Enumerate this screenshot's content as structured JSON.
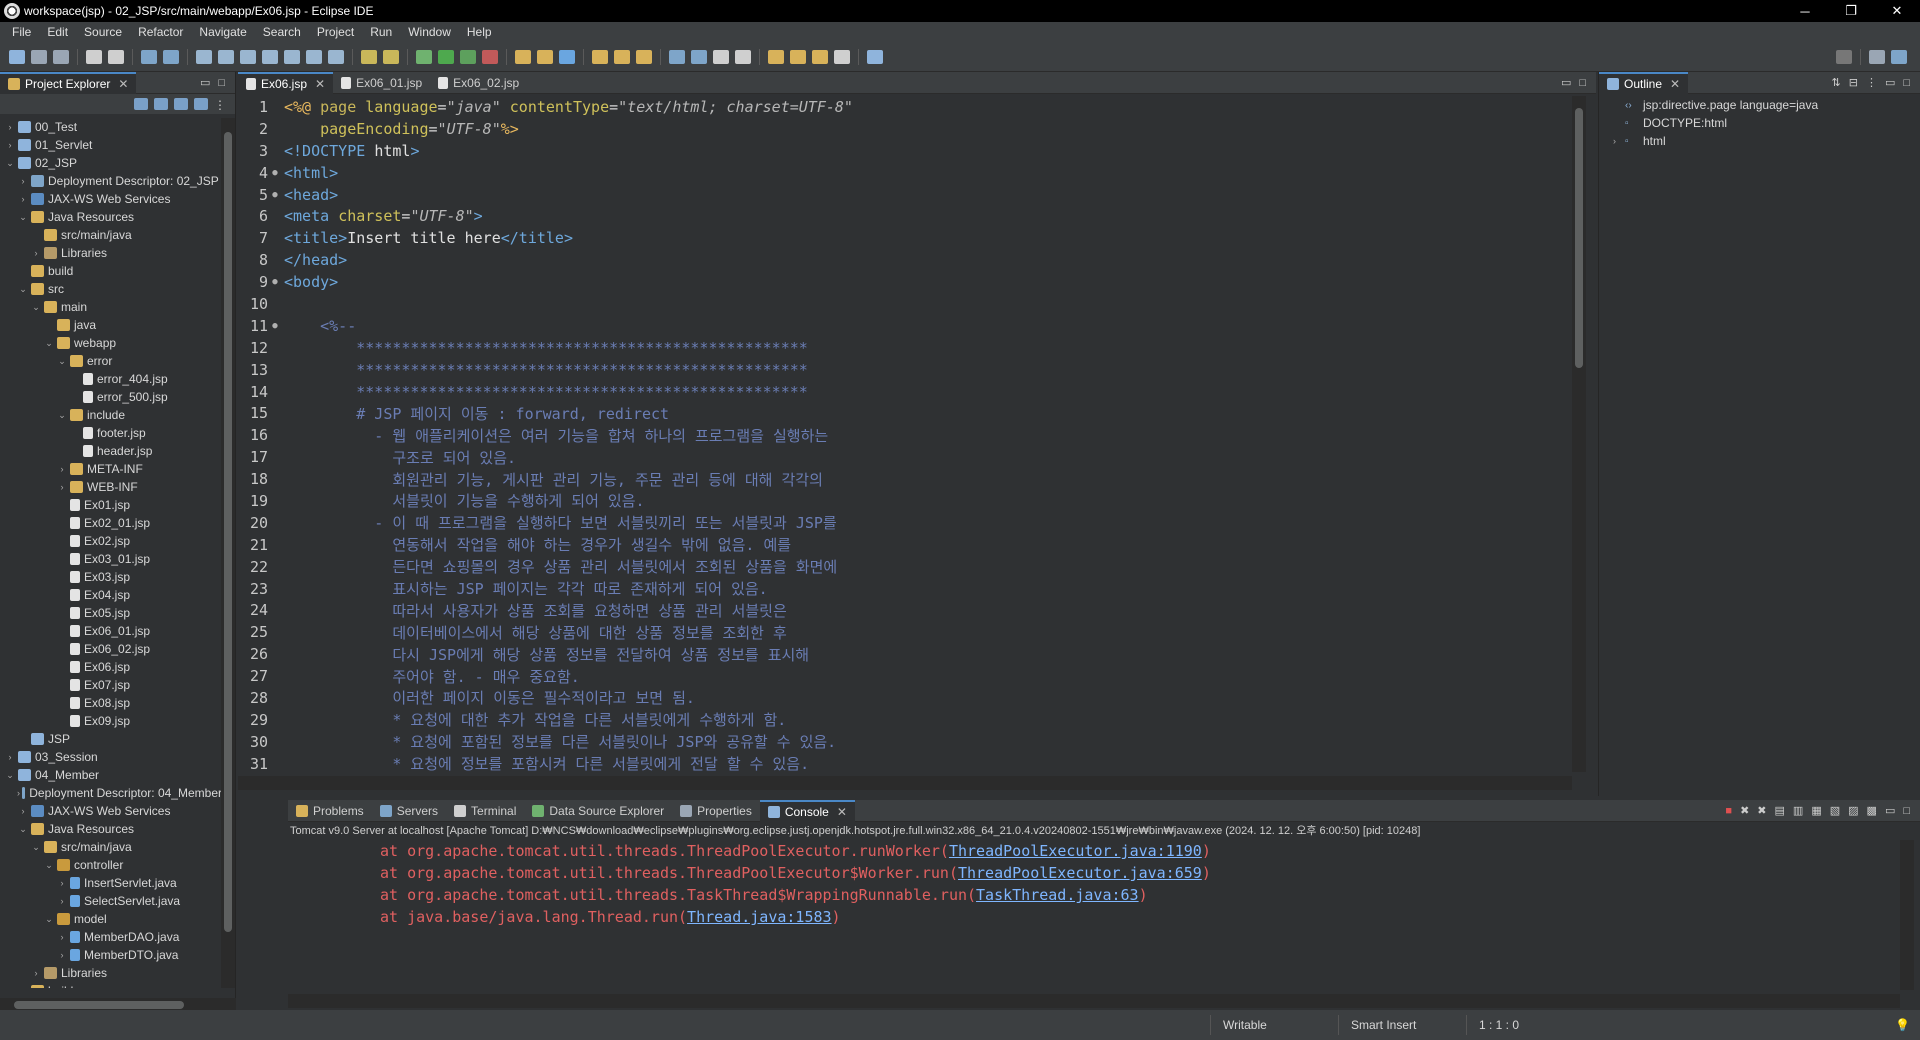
{
  "window": {
    "title": "workspace(jsp) - 02_JSP/src/main/webapp/Ex06.jsp - Eclipse IDE",
    "min": "─",
    "max": "❐",
    "close": "✕"
  },
  "menu": [
    "File",
    "Edit",
    "Source",
    "Refactor",
    "Navigate",
    "Search",
    "Project",
    "Run",
    "Window",
    "Help"
  ],
  "explorer": {
    "tab_label": "Project Explorer",
    "tree": [
      {
        "depth": 0,
        "arrow": "›",
        "icon": "proj",
        "label": "00_Test"
      },
      {
        "depth": 0,
        "arrow": "›",
        "icon": "proj",
        "label": "01_Servlet"
      },
      {
        "depth": 0,
        "arrow": "⌄",
        "icon": "proj",
        "label": "02_JSP"
      },
      {
        "depth": 1,
        "arrow": "›",
        "icon": "desc",
        "label": "Deployment Descriptor: 02_JSP"
      },
      {
        "depth": 1,
        "arrow": "›",
        "icon": "ws",
        "label": "JAX-WS Web Services"
      },
      {
        "depth": 1,
        "arrow": "⌄",
        "icon": "folder",
        "label": "Java Resources"
      },
      {
        "depth": 2,
        "arrow": "",
        "icon": "folder",
        "label": "src/main/java"
      },
      {
        "depth": 2,
        "arrow": "›",
        "icon": "lib",
        "label": "Libraries"
      },
      {
        "depth": 1,
        "arrow": "",
        "icon": "folder",
        "label": "build"
      },
      {
        "depth": 1,
        "arrow": "⌄",
        "icon": "folder",
        "label": "src"
      },
      {
        "depth": 2,
        "arrow": "⌄",
        "icon": "folder",
        "label": "main"
      },
      {
        "depth": 3,
        "arrow": "",
        "icon": "folder",
        "label": "java"
      },
      {
        "depth": 3,
        "arrow": "⌄",
        "icon": "folder",
        "label": "webapp"
      },
      {
        "depth": 4,
        "arrow": "⌄",
        "icon": "folder",
        "label": "error"
      },
      {
        "depth": 5,
        "arrow": "",
        "icon": "file",
        "label": "error_404.jsp"
      },
      {
        "depth": 5,
        "arrow": "",
        "icon": "file",
        "label": "error_500.jsp"
      },
      {
        "depth": 4,
        "arrow": "⌄",
        "icon": "folder",
        "label": "include"
      },
      {
        "depth": 5,
        "arrow": "",
        "icon": "file",
        "label": "footer.jsp"
      },
      {
        "depth": 5,
        "arrow": "",
        "icon": "file",
        "label": "header.jsp"
      },
      {
        "depth": 4,
        "arrow": "›",
        "icon": "folder",
        "label": "META-INF"
      },
      {
        "depth": 4,
        "arrow": "›",
        "icon": "folder",
        "label": "WEB-INF"
      },
      {
        "depth": 4,
        "arrow": "",
        "icon": "file",
        "label": "Ex01.jsp"
      },
      {
        "depth": 4,
        "arrow": "",
        "icon": "file",
        "label": "Ex02_01.jsp"
      },
      {
        "depth": 4,
        "arrow": "",
        "icon": "file",
        "label": "Ex02.jsp"
      },
      {
        "depth": 4,
        "arrow": "",
        "icon": "file",
        "label": "Ex03_01.jsp"
      },
      {
        "depth": 4,
        "arrow": "",
        "icon": "file",
        "label": "Ex03.jsp"
      },
      {
        "depth": 4,
        "arrow": "",
        "icon": "file",
        "label": "Ex04.jsp"
      },
      {
        "depth": 4,
        "arrow": "",
        "icon": "file",
        "label": "Ex05.jsp"
      },
      {
        "depth": 4,
        "arrow": "",
        "icon": "file",
        "label": "Ex06_01.jsp"
      },
      {
        "depth": 4,
        "arrow": "",
        "icon": "file",
        "label": "Ex06_02.jsp"
      },
      {
        "depth": 4,
        "arrow": "",
        "icon": "file",
        "label": "Ex06.jsp"
      },
      {
        "depth": 4,
        "arrow": "",
        "icon": "file",
        "label": "Ex07.jsp"
      },
      {
        "depth": 4,
        "arrow": "",
        "icon": "file",
        "label": "Ex08.jsp"
      },
      {
        "depth": 4,
        "arrow": "",
        "icon": "file",
        "label": "Ex09.jsp"
      },
      {
        "depth": 1,
        "arrow": "",
        "icon": "proj",
        "label": "JSP"
      },
      {
        "depth": 0,
        "arrow": "›",
        "icon": "proj",
        "label": "03_Session"
      },
      {
        "depth": 0,
        "arrow": "⌄",
        "icon": "proj",
        "label": "04_Member"
      },
      {
        "depth": 1,
        "arrow": "›",
        "icon": "desc",
        "label": "Deployment Descriptor: 04_Member"
      },
      {
        "depth": 1,
        "arrow": "›",
        "icon": "ws",
        "label": "JAX-WS Web Services"
      },
      {
        "depth": 1,
        "arrow": "⌄",
        "icon": "folder",
        "label": "Java Resources"
      },
      {
        "depth": 2,
        "arrow": "⌄",
        "icon": "folder",
        "label": "src/main/java"
      },
      {
        "depth": 3,
        "arrow": "⌄",
        "icon": "pkg",
        "label": "controller"
      },
      {
        "depth": 4,
        "arrow": "›",
        "icon": "java",
        "label": "InsertServlet.java"
      },
      {
        "depth": 4,
        "arrow": "›",
        "icon": "java",
        "label": "SelectServlet.java"
      },
      {
        "depth": 3,
        "arrow": "⌄",
        "icon": "pkg",
        "label": "model"
      },
      {
        "depth": 4,
        "arrow": "›",
        "icon": "java",
        "label": "MemberDAO.java"
      },
      {
        "depth": 4,
        "arrow": "›",
        "icon": "java",
        "label": "MemberDTO.java"
      },
      {
        "depth": 2,
        "arrow": "›",
        "icon": "lib",
        "label": "Libraries"
      },
      {
        "depth": 1,
        "arrow": "›",
        "icon": "folder",
        "label": "build"
      }
    ]
  },
  "editor": {
    "tabs": [
      {
        "label": "Ex06.jsp",
        "active": true
      },
      {
        "label": "Ex06_01.jsp",
        "active": false
      },
      {
        "label": "Ex06_02.jsp",
        "active": false
      }
    ],
    "lines": [
      {
        "n": "1",
        "fold": "",
        "html": "<span class='kw'>&lt;%@</span> <span class='dir'>page</span> <span class='attr'>language</span>=<span class='val'>\"java\"</span> <span class='attr'>contentType</span>=<span class='val'>\"text/html; charset=UTF-8\"</span>"
      },
      {
        "n": "2",
        "fold": "",
        "html": "    <span class='attr'>pageEncoding</span>=<span class='val'>\"UTF-8\"</span><span class='kw'>%&gt;</span>"
      },
      {
        "n": "3",
        "fold": "",
        "html": "<span class='tag'>&lt;!DOCTYPE</span> <span class='text'>html</span><span class='tag'>&gt;</span>"
      },
      {
        "n": "4",
        "fold": "●",
        "html": "<span class='tag'>&lt;html&gt;</span>"
      },
      {
        "n": "5",
        "fold": "●",
        "html": "<span class='tag'>&lt;head&gt;</span>"
      },
      {
        "n": "6",
        "fold": "",
        "html": "<span class='tag'>&lt;meta</span> <span class='attr'>charset</span>=<span class='val'>\"UTF-8\"</span><span class='tag'>&gt;</span>"
      },
      {
        "n": "7",
        "fold": "",
        "html": "<span class='tag'>&lt;title&gt;</span><span class='text'>Insert title here</span><span class='tag'>&lt;/title&gt;</span>"
      },
      {
        "n": "8",
        "fold": "",
        "html": "<span class='tag'>&lt;/head&gt;</span>"
      },
      {
        "n": "9",
        "fold": "●",
        "html": "<span class='tag'>&lt;body&gt;</span>"
      },
      {
        "n": "10",
        "fold": "",
        "html": ""
      },
      {
        "n": "11",
        "fold": "●",
        "html": "    <span class='cmt'>&lt;%--</span>"
      },
      {
        "n": "12",
        "fold": "",
        "html": "<span class='cmt'>        **************************************************</span>"
      },
      {
        "n": "13",
        "fold": "",
        "html": "<span class='cmt'>        **************************************************</span>"
      },
      {
        "n": "14",
        "fold": "",
        "html": "<span class='cmt'>        **************************************************</span>"
      },
      {
        "n": "15",
        "fold": "",
        "html": "<span class='cmt'>        # JSP 페이지 이동 : forward, redirect</span>"
      },
      {
        "n": "16",
        "fold": "",
        "html": "<span class='cmt'>          - 웹 애플리케이션은 여러 기능을 합쳐 하나의 프로그램을 실행하는</span>"
      },
      {
        "n": "17",
        "fold": "",
        "html": "<span class='cmt'>            구조로 되어 있음.</span>"
      },
      {
        "n": "18",
        "fold": "",
        "html": "<span class='cmt'>            회원관리 기능, 게시판 관리 기능, 주문 관리 등에 대해 각각의</span>"
      },
      {
        "n": "19",
        "fold": "",
        "html": "<span class='cmt'>            서블릿이 기능을 수행하게 되어 있음.</span>"
      },
      {
        "n": "20",
        "fold": "",
        "html": "<span class='cmt'>          - 이 때 프로그램을 실행하다 보면 서블릿끼리 또는 서블릿과 JSP를</span>"
      },
      {
        "n": "21",
        "fold": "",
        "html": "<span class='cmt'>            연동해서 작업을 해야 하는 경우가 생길수 밖에 없음. 예를</span>"
      },
      {
        "n": "22",
        "fold": "",
        "html": "<span class='cmt'>            든다면 쇼핑몰의 경우 상품 관리 서블릿에서 조회된 상품을 화면에</span>"
      },
      {
        "n": "23",
        "fold": "",
        "html": "<span class='cmt'>            표시하는 JSP 페이지는 각각 따로 존재하게 되어 있음.</span>"
      },
      {
        "n": "24",
        "fold": "",
        "html": "<span class='cmt'>            따라서 사용자가 상품 조회를 요청하면 상품 관리 서블릿은</span>"
      },
      {
        "n": "25",
        "fold": "",
        "html": "<span class='cmt'>            데이터베이스에서 해당 상품에 대한 상품 정보를 조회한 후</span>"
      },
      {
        "n": "26",
        "fold": "",
        "html": "<span class='cmt'>            다시 JSP에게 해당 상품 정보를 전달하여 상품 정보를 표시해</span>"
      },
      {
        "n": "27",
        "fold": "",
        "html": "<span class='cmt'>            주어야 함. - 매우 중요함.</span>"
      },
      {
        "n": "28",
        "fold": "",
        "html": "<span class='cmt'>            이러한 페이지 이동은 필수적이라고 보면 됨.</span>"
      },
      {
        "n": "29",
        "fold": "",
        "html": "<span class='cmt'>            * 요청에 대한 추가 작업을 다른 서블릿에게 수행하게 함.</span>"
      },
      {
        "n": "30",
        "fold": "",
        "html": "<span class='cmt'>            * 요청에 포함된 정보를 다른 서블릿이나 JSP와 공유할 수 있음.</span>"
      },
      {
        "n": "31",
        "fold": "",
        "html": "<span class='cmt'>            * 요청에 정보를 포함시켜 다른 서블릿에게 전달 할 수 있음.</span>"
      }
    ]
  },
  "outline": {
    "tab_label": "Outline",
    "items": [
      {
        "arrow": "",
        "icon": "‹›",
        "label": "jsp:directive.page language=java"
      },
      {
        "arrow": "",
        "icon": "▫",
        "label": "DOCTYPE:html"
      },
      {
        "arrow": "›",
        "icon": "▫",
        "label": "html"
      }
    ]
  },
  "bottom": {
    "tabs": [
      {
        "label": "Problems",
        "active": false
      },
      {
        "label": "Servers",
        "active": false
      },
      {
        "label": "Terminal",
        "active": false
      },
      {
        "label": "Data Source Explorer",
        "active": false
      },
      {
        "label": "Properties",
        "active": false
      },
      {
        "label": "Console",
        "active": true
      }
    ],
    "console_status": "Tomcat v9.0 Server at localhost [Apache Tomcat] D:₩NCS₩download₩eclipse₩plugins₩org.eclipse.justj.openjdk.hotspot.jre.full.win32.x86_64_21.0.4.v20240802-1551₩jre₩bin₩javaw.exe  (2024. 12. 12. 오후 6:00:50) [pid: 10248]",
    "console_lines": [
      {
        "prefix": "at org.apache.tomcat.util.threads.ThreadPoolExecutor.runWorker(",
        "link": "ThreadPoolExecutor.java:1190",
        "suffix": ")"
      },
      {
        "prefix": "at org.apache.tomcat.util.threads.ThreadPoolExecutor$Worker.run(",
        "link": "ThreadPoolExecutor.java:659",
        "suffix": ")"
      },
      {
        "prefix": "at org.apache.tomcat.util.threads.TaskThread$WrappingRunnable.run(",
        "link": "TaskThread.java:63",
        "suffix": ")"
      },
      {
        "prefix": "at java.base/java.lang.Thread.run(",
        "link": "Thread.java:1583",
        "suffix": ")"
      }
    ]
  },
  "statusbar": {
    "mode": "Writable",
    "insert": "Smart Insert",
    "position": "1 : 1 : 0"
  }
}
